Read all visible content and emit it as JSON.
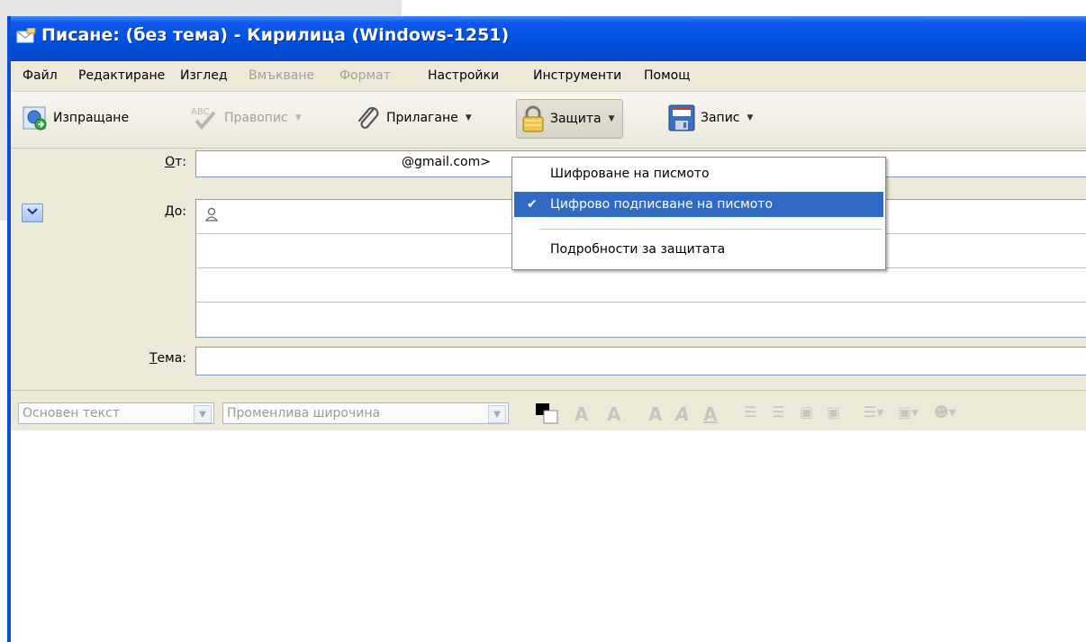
{
  "window": {
    "title": "Писане: (без тема) - Кирилица (Windows-1251)"
  },
  "menubar": {
    "items": [
      {
        "label": "Файл",
        "enabled": true
      },
      {
        "label": "Редактиране",
        "enabled": true
      },
      {
        "label": "Изглед",
        "enabled": true
      },
      {
        "label": "Вмъкване",
        "enabled": false
      },
      {
        "label": "Формат",
        "enabled": false
      },
      {
        "label": "Настройки",
        "enabled": true
      },
      {
        "label": "Инструменти",
        "enabled": true
      },
      {
        "label": "Помощ",
        "enabled": true
      }
    ]
  },
  "toolbar": {
    "send_label": "Изпращане",
    "spell_label": "Правопис",
    "spell_icon_text": "ABC",
    "attach_label": "Прилагане",
    "security_label": "Защита",
    "save_label": "Запис"
  },
  "header": {
    "from_label": "От:",
    "from_value": "@gmail.com>",
    "to_label": "До:",
    "subject_label": "Тема:",
    "subject_value": ""
  },
  "security_menu": {
    "items": [
      {
        "label": "Шифроване на писмото",
        "checked": false,
        "selected": false
      },
      {
        "label": "Цифрово подписване на писмото",
        "checked": true,
        "selected": true
      },
      {
        "label": "Подробности за защитата",
        "checked": false,
        "selected": false
      }
    ]
  },
  "format_bar": {
    "paragraph_style": "Основен текст",
    "font_family": "Променлива широчина"
  },
  "colors": {
    "title_blue": "#0050e0",
    "menu_bg": "#ece9d8",
    "selection": "#316ac5"
  }
}
